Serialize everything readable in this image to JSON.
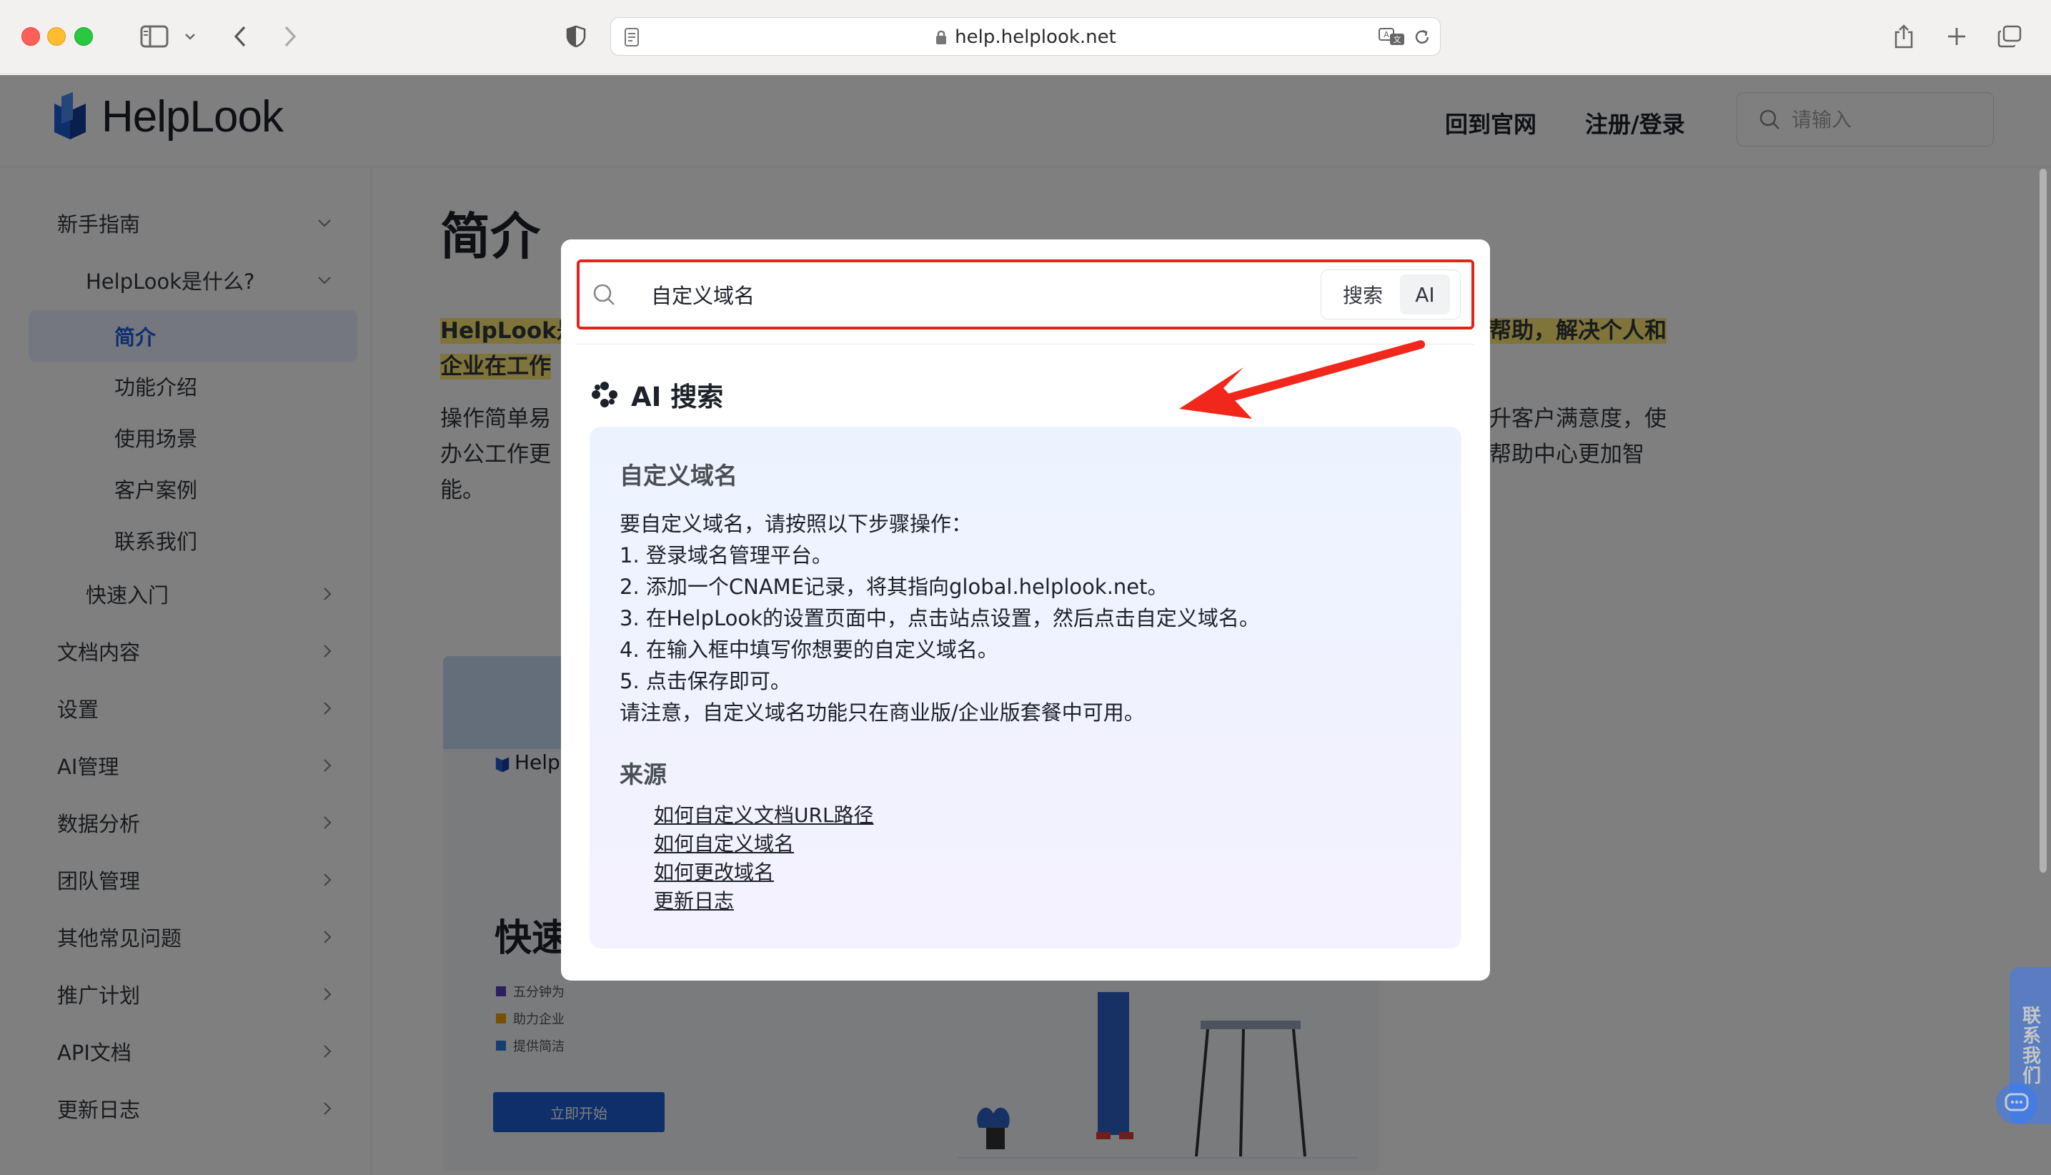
{
  "browser": {
    "url": "help.helplook.net"
  },
  "header": {
    "logo_text": "HelpLook",
    "links": [
      "回到官网",
      "注册/登录"
    ],
    "search_placeholder": "请输入"
  },
  "sidebar": {
    "items": [
      {
        "label": "新手指南"
      },
      {
        "label": "HelpLook是什么?"
      },
      {
        "label": "简介"
      },
      {
        "label": "功能介绍"
      },
      {
        "label": "使用场景"
      },
      {
        "label": "客户案例"
      },
      {
        "label": "联系我们"
      },
      {
        "label": "快速入门"
      },
      {
        "label": "文档内容"
      },
      {
        "label": "设置"
      },
      {
        "label": "AI管理"
      },
      {
        "label": "数据分析"
      },
      {
        "label": "团队管理"
      },
      {
        "label": "其他常见问题"
      },
      {
        "label": "推广计划"
      },
      {
        "label": "API文档"
      },
      {
        "label": "更新日志"
      }
    ]
  },
  "content": {
    "title": "简介",
    "highlight_left_1": "HelpLook是",
    "highlight_left_2": "企业在工作",
    "highlight_right": "帮助，解决个人和",
    "para_left": [
      "操作简单易",
      "办公工作更",
      "能。"
    ],
    "para_right": [
      "升客户满意度，使",
      "帮助中心更加智"
    ],
    "preview_logo": "Help",
    "preview_heading": "快速",
    "preview_bullets": [
      "五分钟为",
      "助力企业",
      "提供简洁"
    ],
    "preview_button": "立即开始"
  },
  "modal": {
    "query": "自定义域名",
    "btn_search": "搜索",
    "btn_ai": "AI",
    "ai_heading": "AI 搜索",
    "answer_title": "自定义域名",
    "answer_lines": [
      "要自定义域名，请按照以下步骤操作：",
      "1. 登录域名管理平台。",
      "2. 添加一个CNAME记录，将其指向global.helplook.net。",
      "3. 在HelpLook的设置页面中，点击站点设置，然后点击自定义域名。",
      "4. 在输入框中填写你想要的自定义域名。",
      "5. 点击保存即可。",
      "请注意，自定义域名功能只在商业版/企业版套餐中可用。"
    ],
    "source_label": "来源",
    "sources": [
      "如何自定义文档URL路径",
      "如何自定义域名",
      "如何更改域名",
      "更新日志"
    ]
  },
  "widget": {
    "contact_label": "联系我们"
  },
  "colors": {
    "accent": "#1b5fe0",
    "highlight": "#e2231a",
    "arrow": "#f2271c"
  }
}
